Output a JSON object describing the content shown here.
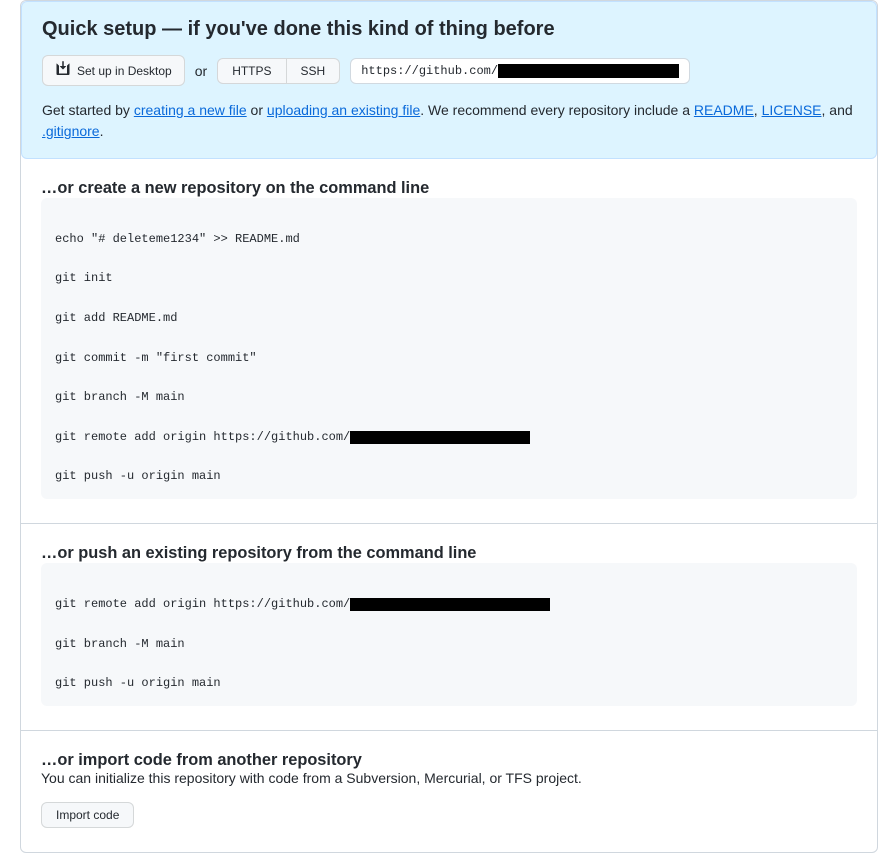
{
  "quickSetup": {
    "title": "Quick setup — if you've done this kind of thing before",
    "desktopBtn": "Set up in Desktop",
    "orText": "or",
    "httpsBtn": "HTTPS",
    "sshBtn": "SSH",
    "urlPrefix": "https://github.com/",
    "footer": {
      "prefix": "Get started by ",
      "link1": "creating a new file",
      "mid1": " or ",
      "link2": "uploading an existing file",
      "mid2": ". We recommend every repository include a ",
      "readme": "README",
      "sep1": ", ",
      "license": "LICENSE",
      "sep2": ", and ",
      "gitignore": ".gitignore",
      "end": "."
    }
  },
  "createSection": {
    "title": "…or create a new repository on the command line",
    "lines": {
      "l1": "echo \"# deleteme1234\" >> README.md",
      "l2": "git init",
      "l3": "git add README.md",
      "l4": "git commit -m \"first commit\"",
      "l5": "git branch -M main",
      "l6prefix": "git remote add origin https://github.com/",
      "l7": "git push -u origin main"
    }
  },
  "pushSection": {
    "title": "…or push an existing repository from the command line",
    "lines": {
      "l1prefix": "git remote add origin https://github.com/",
      "l2": "git branch -M main",
      "l3": "git push -u origin main"
    }
  },
  "importSection": {
    "title": "…or import code from another repository",
    "description": "You can initialize this repository with code from a Subversion, Mercurial, or TFS project.",
    "button": "Import code"
  }
}
